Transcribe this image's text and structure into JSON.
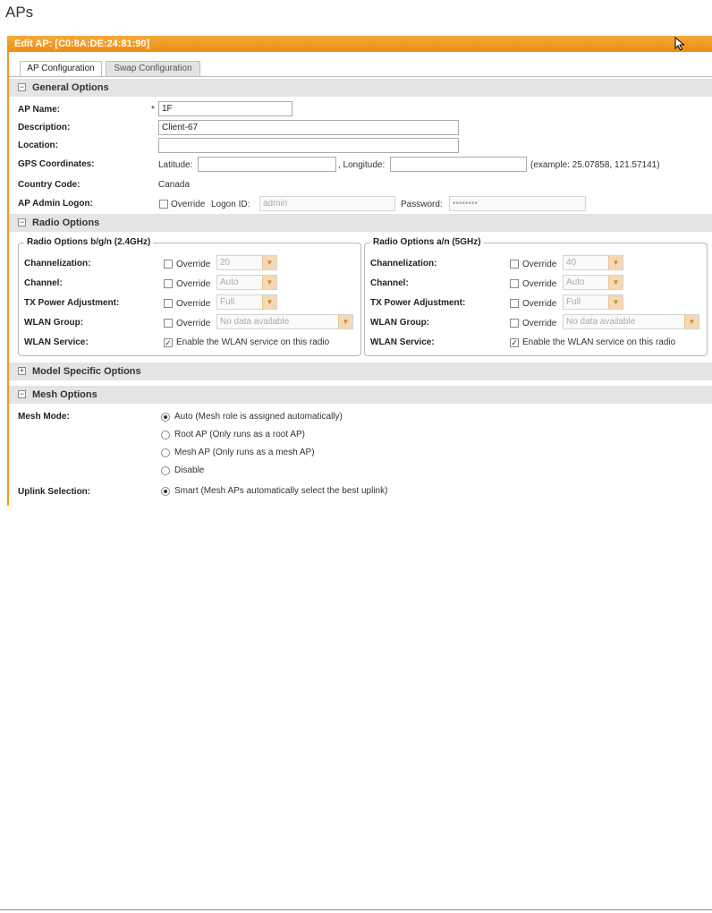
{
  "page": {
    "title": "APs"
  },
  "panel": {
    "title": "Edit AP: [C0:8A:DE:24:81:90]"
  },
  "tabs": [
    {
      "label": "AP Configuration",
      "active": true
    },
    {
      "label": "Swap Configuration",
      "active": false
    }
  ],
  "general": {
    "title": "General Options",
    "toggle": "−",
    "ap_name": {
      "label": "AP Name:",
      "required": "*",
      "value": "1F"
    },
    "description": {
      "label": "Description:",
      "value": "Client-67"
    },
    "location": {
      "label": "Location:",
      "value": ""
    },
    "gps": {
      "label": "GPS Coordinates:",
      "latitude_label": "Latitude:",
      "latitude_value": "",
      "longitude_label": ", Longitude:",
      "longitude_value": "",
      "example": "(example: 25.07858, 121.57141)"
    },
    "country": {
      "label": "Country Code:",
      "value": "Canada"
    },
    "admin": {
      "label": "AP Admin Logon:",
      "override_label": "Override",
      "logon_label": "Logon ID:",
      "logon_value": "admin",
      "password_label": "Password:",
      "password_value": "••••••••"
    }
  },
  "radio": {
    "title": "Radio Options",
    "toggle": "−",
    "bgn": {
      "legend": "Radio Options b/g/n (2.4GHz)",
      "channelization": {
        "label": "Channelization:",
        "override": "Override",
        "value": "20"
      },
      "channel": {
        "label": "Channel:",
        "override": "Override",
        "value": "Auto"
      },
      "tx": {
        "label": "TX Power Adjustment:",
        "override": "Override",
        "value": "Full"
      },
      "wlan_group": {
        "label": "WLAN Group:",
        "override": "Override",
        "value": "No data available"
      },
      "wlan_service": {
        "label": "WLAN Service:",
        "text": "Enable the WLAN service on this radio",
        "check": "✓"
      }
    },
    "an": {
      "legend": "Radio Options a/n (5GHz)",
      "channelization": {
        "label": "Channelization:",
        "override": "Override",
        "value": "40"
      },
      "channel": {
        "label": "Channel:",
        "override": "Override",
        "value": "Auto"
      },
      "tx": {
        "label": "TX Power Adjustment:",
        "override": "Override",
        "value": "Full"
      },
      "wlan_group": {
        "label": "WLAN Group:",
        "override": "Override",
        "value": "No data available"
      },
      "wlan_service": {
        "label": "WLAN Service:",
        "text": "Enable the WLAN service on this radio",
        "check": "✓"
      }
    }
  },
  "model": {
    "title": "Model Specific Options",
    "toggle": "+"
  },
  "mesh": {
    "title": "Mesh Options",
    "toggle": "−",
    "mode_label": "Mesh Mode:",
    "modes": [
      {
        "label": "Auto (Mesh role is assigned automatically)",
        "selected": true
      },
      {
        "label": "Root AP (Only runs as a root AP)",
        "selected": false
      },
      {
        "label": "Mesh AP (Only runs as a mesh AP)",
        "selected": false
      },
      {
        "label": "Disable",
        "selected": false
      }
    ],
    "uplink_label": "Uplink Selection:",
    "uplink_value": "Smart (Mesh APs automatically select the best uplink)"
  },
  "colors": {
    "accent": "#f39a1e",
    "section_bg": "#e4e4e4"
  },
  "icons": {
    "cursor": "mouse-pointer-icon",
    "arrow": "chevron-down-icon"
  }
}
